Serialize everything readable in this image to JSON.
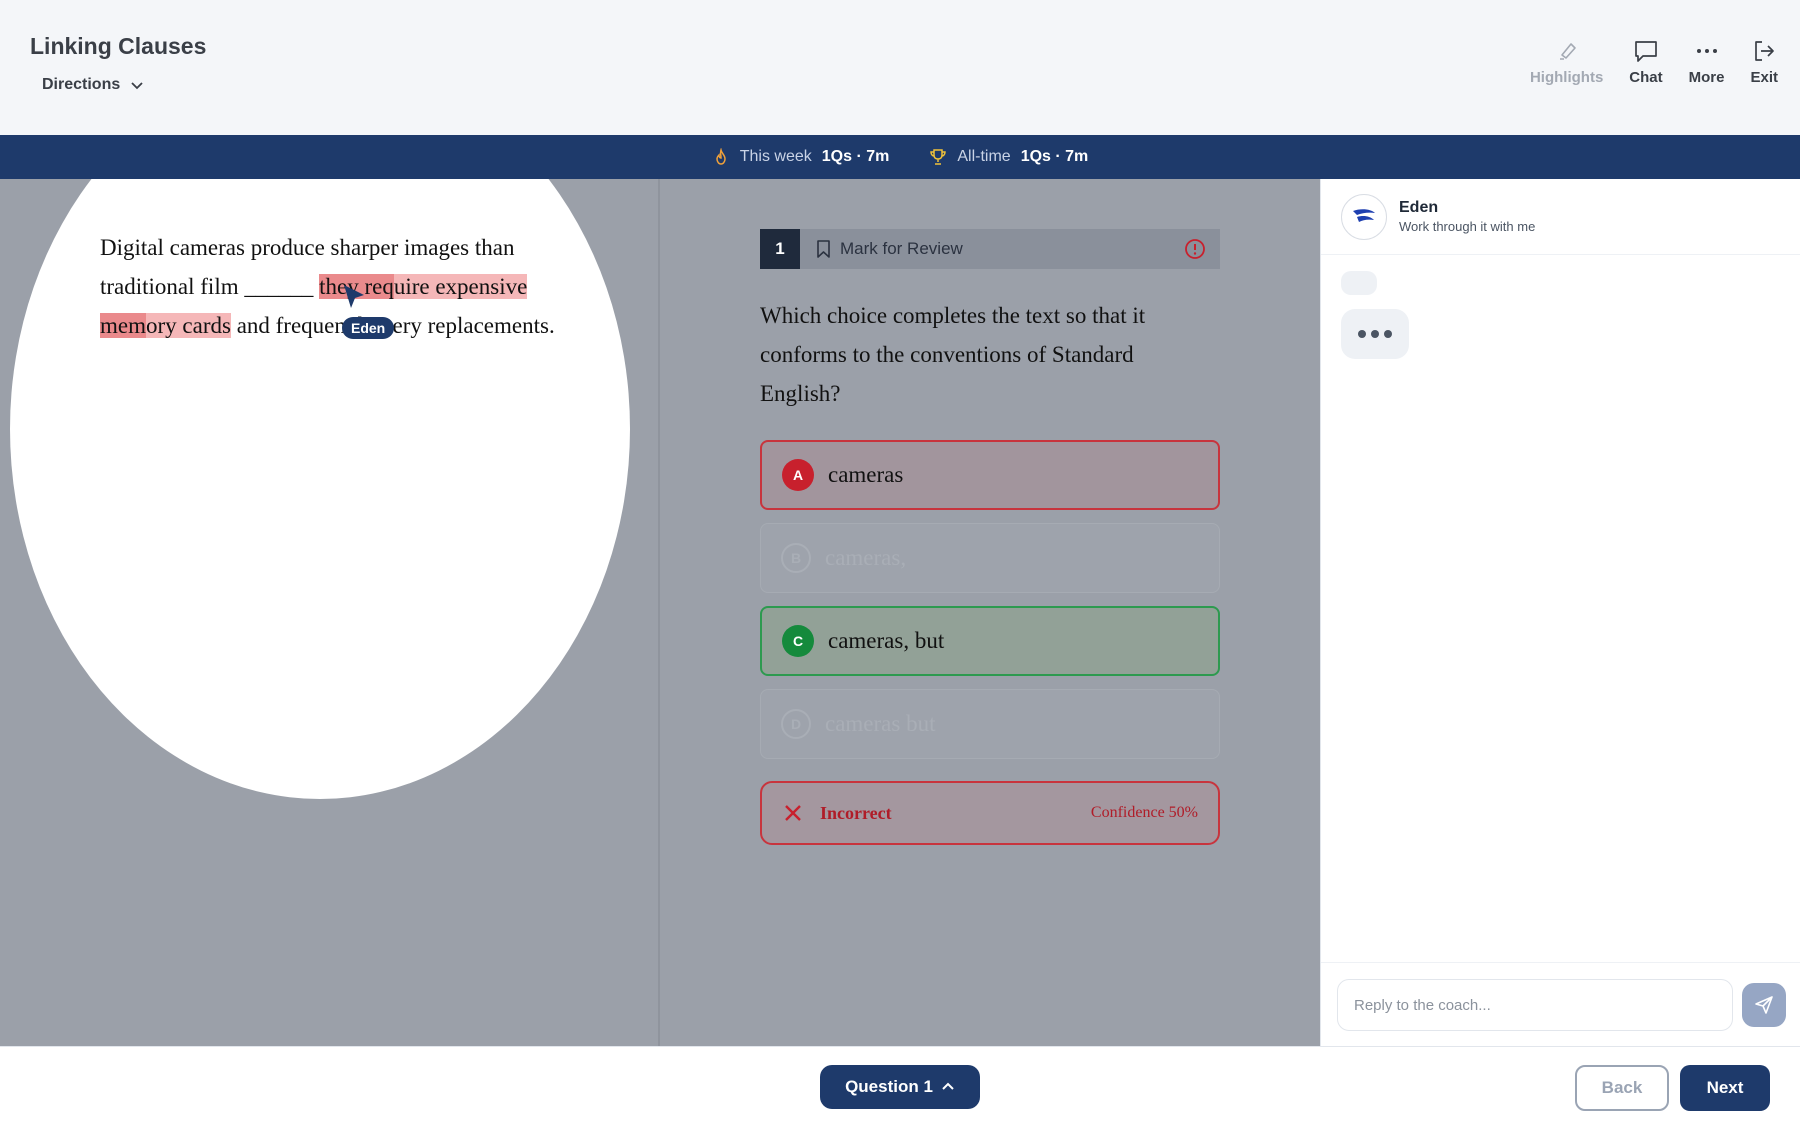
{
  "header": {
    "title": "Linking Clauses",
    "directions_label": "Directions",
    "tools": {
      "highlights": "Highlights",
      "chat": "Chat",
      "more": "More",
      "exit": "Exit"
    }
  },
  "stats": {
    "week_label": "This week",
    "week_value": "1Qs · 7m",
    "alltime_label": "All-time",
    "alltime_value": "1Qs · 7m"
  },
  "passage": {
    "part1": "Digital cameras produce sharper images than traditional film ______ ",
    "hl1_strong": "they req",
    "hl1": "uire expensive",
    "hl2_strong": "mem",
    "hl2": "ory cards",
    "part2": " and frequent battery replacements.",
    "cursor_label": "Eden"
  },
  "question": {
    "number": "1",
    "mark_label": "Mark for Review",
    "prompt": "Which choice completes the text so that it conforms to the conventions of Standard English?",
    "choices": [
      {
        "letter": "A",
        "text": "cameras",
        "state": "incorrect"
      },
      {
        "letter": "B",
        "text": "cameras,",
        "state": "eliminated"
      },
      {
        "letter": "C",
        "text": "cameras, but",
        "state": "correct"
      },
      {
        "letter": "D",
        "text": "cameras but",
        "state": "eliminated"
      }
    ],
    "result_label": "Incorrect",
    "confidence": "Confidence 50%"
  },
  "chat": {
    "coach_name": "Eden",
    "coach_subtitle": "Work through it with me",
    "reply_placeholder": "Reply to the coach..."
  },
  "footer": {
    "question_pill": "Question 1",
    "back_label": "Back",
    "next_label": "Next"
  },
  "colors": {
    "navy": "#1e3a6b",
    "incorrect": "#c8202d",
    "correct": "#158a3c",
    "highlight": "#f5b7b8"
  }
}
